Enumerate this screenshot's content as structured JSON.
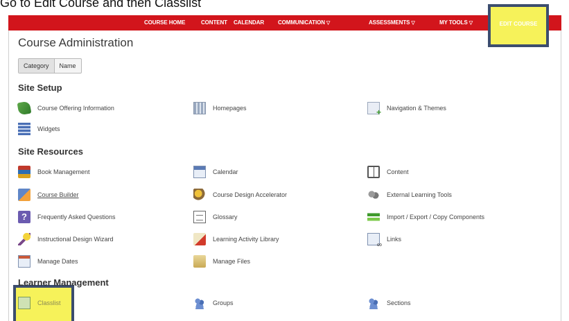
{
  "caption": "Go to Edit Course and then Classlist",
  "navbar": {
    "items": [
      {
        "label": "COURSE HOME",
        "caret": false
      },
      {
        "label": "CONTENT",
        "caret": false
      },
      {
        "label": "CALENDAR",
        "caret": false
      },
      {
        "label": "COMMUNICATION",
        "caret": true
      },
      {
        "label": "ASSESSMENTS",
        "caret": true
      },
      {
        "label": "MY TOOLS",
        "caret": true
      },
      {
        "label": "EDIT COURSE",
        "caret": false
      }
    ],
    "caret_glyph": "▽"
  },
  "page_title": "Course Administration",
  "view_toggle": {
    "category": "Category",
    "name": "Name"
  },
  "sections": {
    "site_setup": "Site Setup",
    "site_resources": "Site Resources",
    "learner_management": "Learner Management"
  },
  "tools": {
    "course_offering_information": "Course Offering Information",
    "homepages": "Homepages",
    "navigation_themes": "Navigation & Themes",
    "widgets": "Widgets",
    "book_management": "Book Management",
    "calendar": "Calendar",
    "content": "Content",
    "course_builder": "Course Builder",
    "course_design_accelerator": "Course Design Accelerator",
    "external_learning_tools": "External Learning Tools",
    "faq": "Frequently Asked Questions",
    "glossary": "Glossary",
    "import_export": "Import / Export / Copy Components",
    "instructional_design_wizard": "Instructional Design Wizard",
    "learning_activity_library": "Learning Activity Library",
    "links": "Links",
    "manage_dates": "Manage Dates",
    "manage_files": "Manage Files",
    "classlist": "Classlist",
    "groups": "Groups",
    "sections": "Sections"
  },
  "colors": {
    "navbar": "#d2151c",
    "highlight": "#f6f25a",
    "highlight_border": "#3c4d6e"
  }
}
